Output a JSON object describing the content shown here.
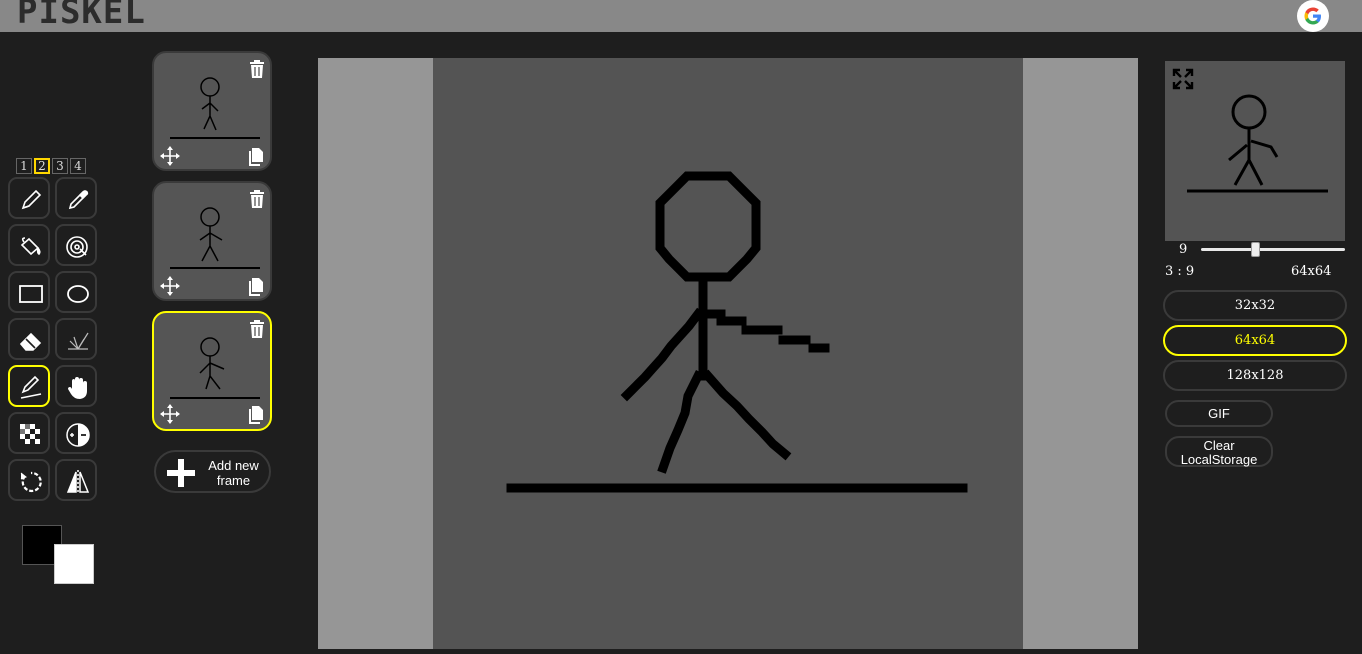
{
  "app": {
    "logo_text": "PISKEL"
  },
  "header": {
    "google_icon": "google-icon"
  },
  "tool_layouts": [
    "1",
    "2",
    "3",
    "4"
  ],
  "tool_layout_selected": "2",
  "tools": [
    {
      "name": "pen-tool",
      "icon": "pencil-icon"
    },
    {
      "name": "color-picker-tool",
      "icon": "eyedropper-icon"
    },
    {
      "name": "paint-bucket-tool",
      "icon": "bucket-icon"
    },
    {
      "name": "paint-same-color-tool",
      "icon": "magic-fill-icon"
    },
    {
      "name": "rectangle-tool",
      "icon": "rectangle-icon"
    },
    {
      "name": "circle-tool",
      "icon": "ellipse-icon"
    },
    {
      "name": "eraser-tool",
      "icon": "eraser-icon"
    },
    {
      "name": "dithering-tool",
      "icon": "lighten-icon"
    },
    {
      "name": "stroke-tool",
      "icon": "stroke-icon",
      "selected": true
    },
    {
      "name": "pan-tool",
      "icon": "hand-icon"
    },
    {
      "name": "checker-tool",
      "icon": "checkerboard-icon"
    },
    {
      "name": "lighten-darken-tool",
      "icon": "contrast-icon"
    },
    {
      "name": "rotate-tool",
      "icon": "rotate-icon"
    },
    {
      "name": "mirror-tool",
      "icon": "mirror-icon"
    }
  ],
  "colors": {
    "primary": "#000000",
    "secondary": "#ffffff",
    "selected_accent": "#ffff00"
  },
  "frames": {
    "count": 3,
    "selected_index": 2,
    "add_frame_label": "Add new frame"
  },
  "preview": {
    "fps": "9",
    "fps_fraction": 0.38,
    "cursor_coords": "3 : 9",
    "canvas_size": "64x64"
  },
  "resize_options": [
    {
      "label": "32x32",
      "selected": false
    },
    {
      "label": "64x64",
      "selected": true
    },
    {
      "label": "128x128",
      "selected": false
    }
  ],
  "actions": {
    "gif_label": "GIF",
    "clear_storage_label": "Clear LocalStorage"
  }
}
